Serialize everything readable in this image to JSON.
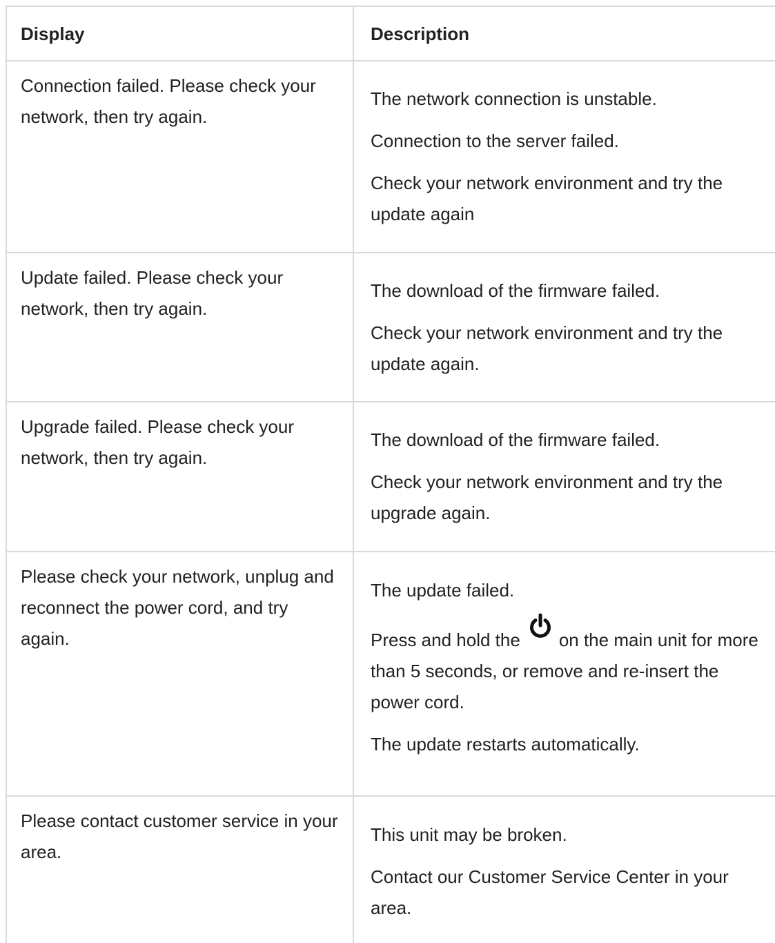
{
  "header": {
    "display": "Display",
    "description": "Description"
  },
  "rows": [
    {
      "display": "Connection failed. Please check your network, then try again.",
      "description": [
        "The network connection is unstable.",
        "Connection to the server failed.",
        "Check your network environment and try the update again"
      ]
    },
    {
      "display": "Update failed. Please check your network, then try again.",
      "description": [
        "The download of the firmware failed.",
        "Check your network environment and try the update again."
      ]
    },
    {
      "display": "Upgrade failed. Please check your network, then try again.",
      "description": [
        "The download of the firmware failed.",
        "Check your network environment and try the upgrade again."
      ]
    },
    {
      "display": "Please check your network, unplug and reconnect the power cord, and try again.",
      "description_1": "The update failed.",
      "description_2_before_icon": "Press and hold the",
      "icon": "power-icon",
      "description_2_after_icon": "on the main unit for more than 5 seconds, or remove and re-insert the power cord.",
      "description_3": "The update restarts automatically."
    },
    {
      "display": "Please contact customer service in your area.",
      "description": [
        "This unit may be broken.",
        "Contact our Customer Service Center in your area."
      ]
    }
  ]
}
